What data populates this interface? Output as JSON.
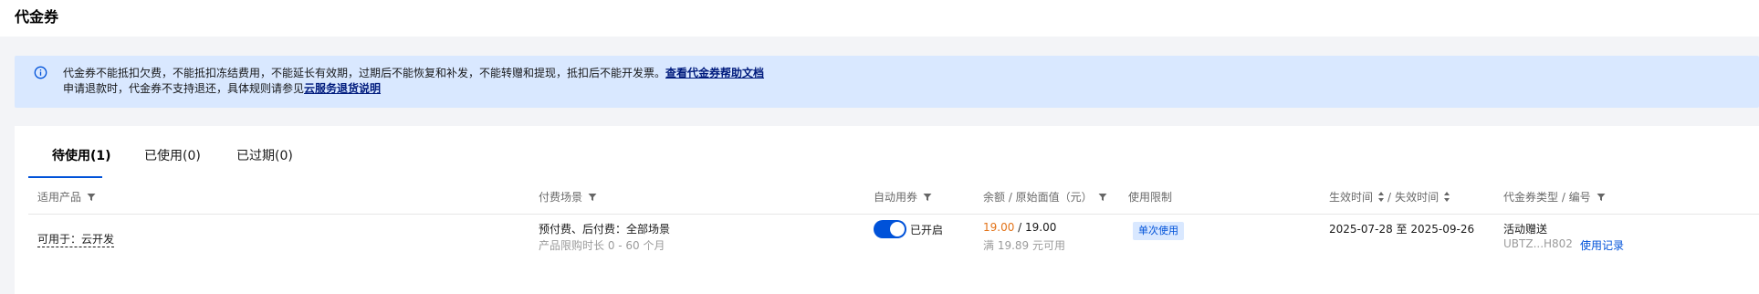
{
  "page": {
    "title": "代金券"
  },
  "notice": {
    "icon": "info-circle-icon",
    "line1": "代金券不能抵扣欠费，不能抵扣冻结费用，不能延长有效期，过期后不能恢复和补发，不能转赠和提现，抵扣后不能开发票。",
    "line1_link": "查看代金券帮助文档",
    "line2": "申请退款时，代金券不支持退还，具体规则请参见",
    "line2_link": "云服务退货说明"
  },
  "tabs": [
    {
      "label": "待使用(1)",
      "active": true
    },
    {
      "label": "已使用(0)",
      "active": false
    },
    {
      "label": "已过期(0)",
      "active": false
    }
  ],
  "columns": {
    "product": "适用产品",
    "scene": "付费场景",
    "auto": "自动用券",
    "balance": "余额 / 原始面值（元）",
    "limit": "使用限制",
    "effective": "生效时间",
    "sep": "/",
    "expire": "失效时间",
    "type": "代金券类型 / 编号"
  },
  "rows": [
    {
      "product": "可用于：云开发",
      "scene_main": "预付费、后付费：全部场景",
      "scene_sub": "产品限购时长 0 - 60 个月",
      "auto_label": "已开启",
      "auto_on": true,
      "balance": "19.00",
      "balance_sep": " / ",
      "original": "19.00",
      "threshold": "满 19.89 元可用",
      "limit": "单次使用",
      "period": "2025-07-28 至 2025-09-26",
      "type": "活动赠送",
      "code": "UBTZ...H802",
      "record_link": "使用记录"
    }
  ],
  "colors": {
    "accent": "#0052d9",
    "notice_bg": "#d9e8ff",
    "balance": "#e37318"
  }
}
